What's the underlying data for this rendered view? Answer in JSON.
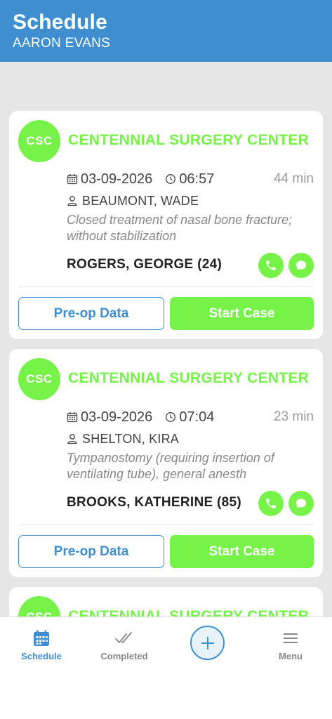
{
  "header": {
    "title": "Schedule",
    "subtitle": "AARON EVANS"
  },
  "colors": {
    "header_bg": "#3f8fd0",
    "accent_green": "#76f249",
    "link_blue": "#3f8fd0",
    "background": "#e6e6e6"
  },
  "cases": [
    {
      "badge": "CSC",
      "facility": "CENTENNIAL SURGERY CENTER",
      "date": "03-09-2026",
      "time": "06:57",
      "duration": "44 min",
      "patient": "BEAUMONT, WADE",
      "procedure": "Closed treatment of nasal bone fracture; without stabilization",
      "surgeon": "ROGERS, GEORGE (24)",
      "preop_label": "Pre-op Data",
      "start_label": "Start Case"
    },
    {
      "badge": "CSC",
      "facility": "CENTENNIAL SURGERY CENTER",
      "date": "03-09-2026",
      "time": "07:04",
      "duration": "23 min",
      "patient": "SHELTON, KIRA",
      "procedure": "Tympanostomy (requiring insertion of ventilating tube), general anesth",
      "surgeon": "BROOKS, KATHERINE (85)",
      "preop_label": "Pre-op Data",
      "start_label": "Start Case"
    },
    {
      "badge": "CSC",
      "facility": "CENTENNIAL SURGERY CENTER"
    }
  ],
  "tabbar": {
    "schedule_label": "Schedule",
    "completed_label": "Completed",
    "menu_label": "Menu",
    "active_tab": "Schedule",
    "icons": [
      "calendar-icon",
      "double-check-icon",
      "plus-icon",
      "hamburger-icon"
    ]
  }
}
